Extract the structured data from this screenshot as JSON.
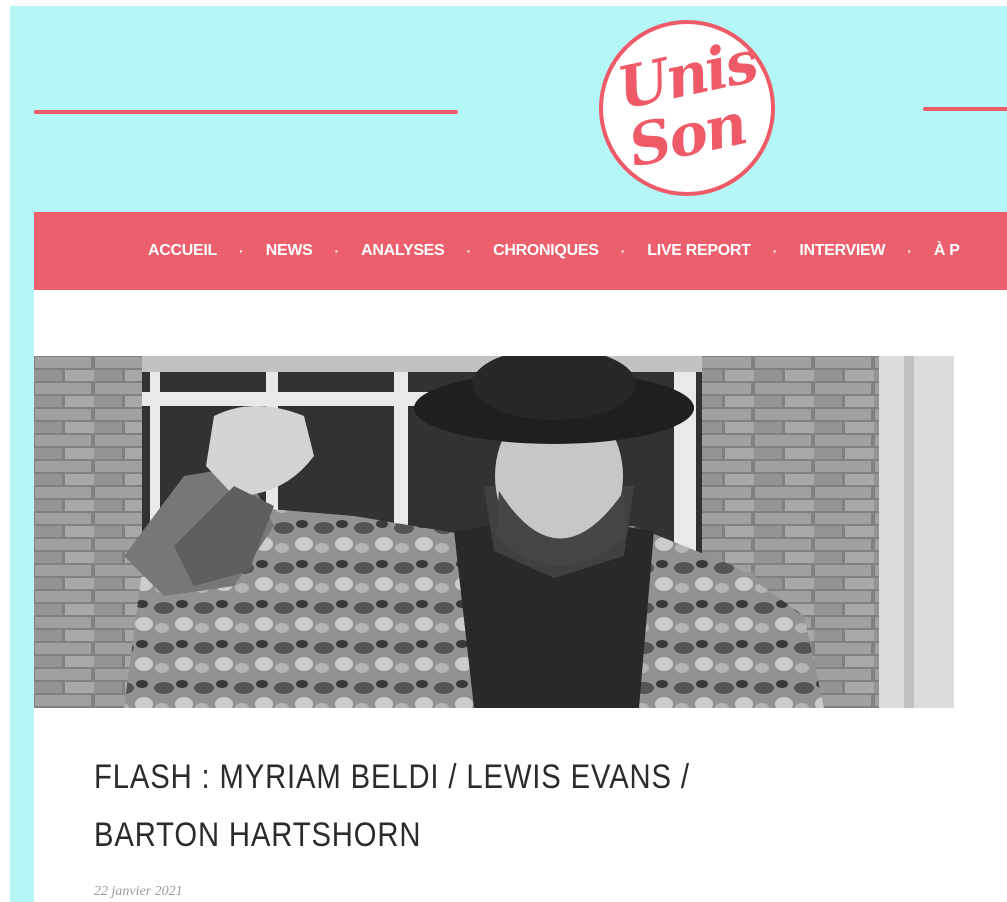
{
  "header": {
    "logo": {
      "text_line1": "Unis",
      "text_line2": "Son",
      "color": "#ef5a68"
    },
    "background_color": "#b4f7f6"
  },
  "nav": {
    "background_color": "#ec5f6d",
    "items": [
      {
        "label": "ACCUEIL"
      },
      {
        "label": "NEWS"
      },
      {
        "label": "ANALYSES"
      },
      {
        "label": "CHRONIQUES"
      },
      {
        "label": "LIVE REPORT"
      },
      {
        "label": "INTERVIEW"
      },
      {
        "label": "À P"
      }
    ],
    "separator": "·"
  },
  "article": {
    "image_icon": "photo-bearded-man-hat-camo-jacket",
    "title": "FLASH : MYRIAM BELDI / LEWIS EVANS / BARTON HARTSHORN",
    "date": "22 janvier 2021"
  }
}
